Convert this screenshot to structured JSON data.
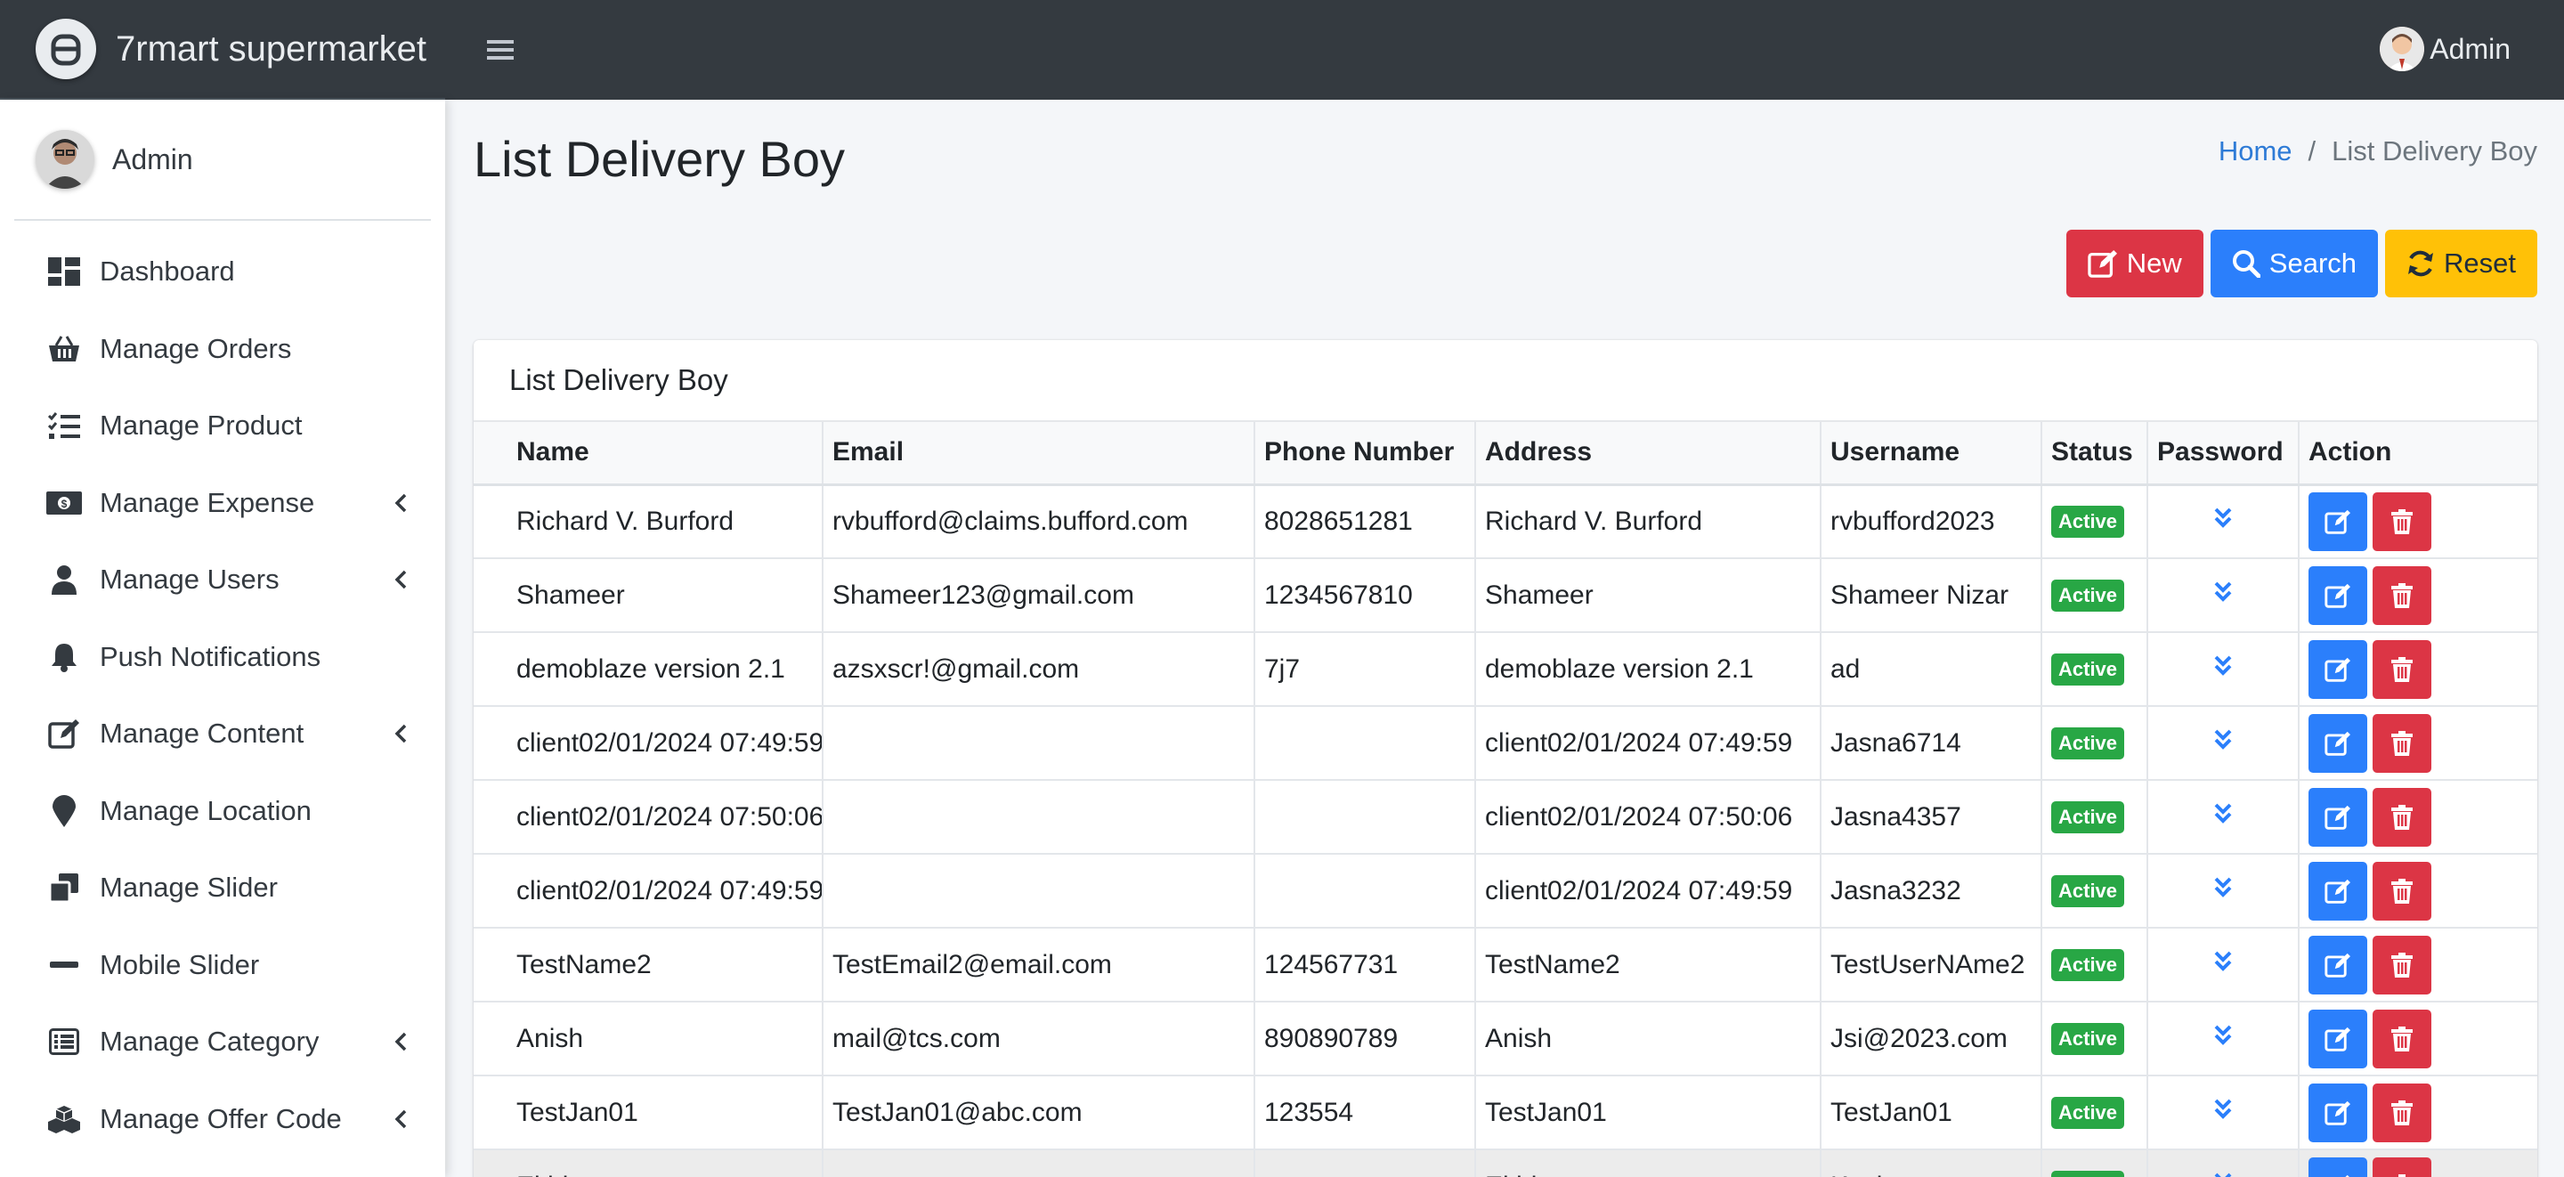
{
  "app": {
    "brand_name": "7rmart supermarket",
    "top_user_name": "Admin"
  },
  "sidebar": {
    "user_name": "Admin",
    "items": [
      {
        "label": "Dashboard",
        "icon": "dashboard-icon",
        "has_chevron": false
      },
      {
        "label": "Manage Orders",
        "icon": "basket-icon",
        "has_chevron": false
      },
      {
        "label": "Manage Product",
        "icon": "tasks-icon",
        "has_chevron": false
      },
      {
        "label": "Manage Expense",
        "icon": "money-bill-icon",
        "has_chevron": true
      },
      {
        "label": "Manage Users",
        "icon": "user-icon",
        "has_chevron": true
      },
      {
        "label": "Push Notifications",
        "icon": "bell-icon",
        "has_chevron": false
      },
      {
        "label": "Manage Content",
        "icon": "edit-icon",
        "has_chevron": true
      },
      {
        "label": "Manage Location",
        "icon": "map-marker-icon",
        "has_chevron": false
      },
      {
        "label": "Manage Slider",
        "icon": "clone-icon",
        "has_chevron": false
      },
      {
        "label": "Mobile Slider",
        "icon": "minus-icon",
        "has_chevron": false
      },
      {
        "label": "Manage Category",
        "icon": "list-alt-icon",
        "has_chevron": true
      },
      {
        "label": "Manage Offer Code",
        "icon": "cubes-icon",
        "has_chevron": true
      }
    ]
  },
  "header": {
    "title": "List Delivery Boy",
    "breadcrumb_home": "Home",
    "breadcrumb_sep": "/",
    "breadcrumb_current": "List Delivery Boy"
  },
  "actions": {
    "new_label": "New",
    "search_label": "Search",
    "reset_label": "Reset"
  },
  "card": {
    "title": "List Delivery Boy"
  },
  "table": {
    "columns": [
      "Name",
      "Email",
      "Phone Number",
      "Address",
      "Username",
      "Status",
      "Password",
      "Action"
    ],
    "rows": [
      {
        "name": "Richard V. Burford",
        "email": "rvbufford@claims.bufford.com",
        "phone": "8028651281",
        "address": "Richard V. Burford",
        "username": "rvbufford2023",
        "status": "Active"
      },
      {
        "name": "Shameer",
        "email": "Shameer123@gmail.com",
        "phone": "1234567810",
        "address": "Shameer",
        "username": "Shameer Nizar",
        "status": "Active"
      },
      {
        "name": "demoblaze version 2.1",
        "email": "azsxscr!@gmail.com",
        "phone": "7j7",
        "address": "demoblaze version 2.1",
        "username": "ad",
        "status": "Active"
      },
      {
        "name": "client02/01/2024 07:49:59",
        "email": "",
        "phone": "",
        "address": "client02/01/2024 07:49:59",
        "username": "Jasna6714",
        "status": "Active"
      },
      {
        "name": "client02/01/2024 07:50:06",
        "email": "",
        "phone": "",
        "address": "client02/01/2024 07:50:06",
        "username": "Jasna4357",
        "status": "Active"
      },
      {
        "name": "client02/01/2024 07:49:59",
        "email": "",
        "phone": "",
        "address": "client02/01/2024 07:49:59",
        "username": "Jasna3232",
        "status": "Active"
      },
      {
        "name": "TestName2",
        "email": "TestEmail2@email.com",
        "phone": "124567731",
        "address": "TestName2",
        "username": "TestUserNAme2",
        "status": "Active"
      },
      {
        "name": "Anish",
        "email": "mail@tcs.com",
        "phone": "890890789",
        "address": "Anish",
        "username": "Jsi@2023.com",
        "status": "Active"
      },
      {
        "name": "TestJan01",
        "email": "TestJan01@abc.com",
        "phone": "123554",
        "address": "TestJan01",
        "username": "TestJan01",
        "status": "Active"
      },
      {
        "name": "Ekhi...",
        "email": "",
        "phone": "",
        "address": "Ekhi...",
        "username": "Kavi...",
        "status": "Active"
      }
    ]
  },
  "colors": {
    "navbar": "#343a40",
    "primary": "#2b7ffb",
    "danger": "#dc3545",
    "warning": "#ffc107",
    "success": "#28a745",
    "link": "#2e7bd6"
  }
}
